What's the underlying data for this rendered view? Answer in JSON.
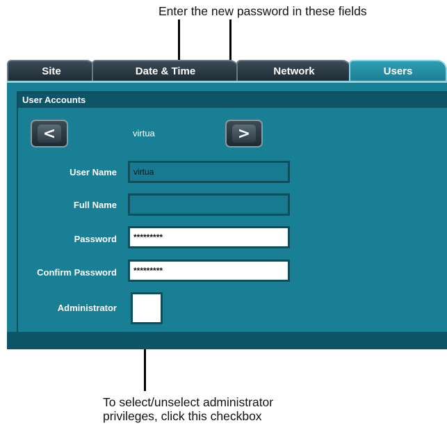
{
  "callouts": {
    "top": "Enter the new password in these fields",
    "bottom_line1": "To select/unselect administrator",
    "bottom_line2": "privileges, click this checkbox"
  },
  "tabs": [
    {
      "label": "Site"
    },
    {
      "label": "Date & Time"
    },
    {
      "label": "Network"
    },
    {
      "label": "Users",
      "active": true
    }
  ],
  "section": {
    "title": "User Accounts"
  },
  "navigator": {
    "prev_icon": "chevron-left-icon",
    "next_icon": "chevron-right-icon",
    "prev_glyph": "<",
    "next_glyph": ">",
    "current_user": "virtua"
  },
  "form": {
    "username_label": "User Name",
    "username_value": "virtua",
    "fullname_label": "Full Name",
    "fullname_value": "",
    "password_label": "Password",
    "password_value": "*********",
    "confirm_label": "Confirm Password",
    "confirm_value": "*********",
    "admin_label": "Administrator",
    "admin_checked": false
  },
  "colors": {
    "panel_bg": "#187f95",
    "header_bg": "#0e5466",
    "active_tab": "#2f9db2"
  }
}
